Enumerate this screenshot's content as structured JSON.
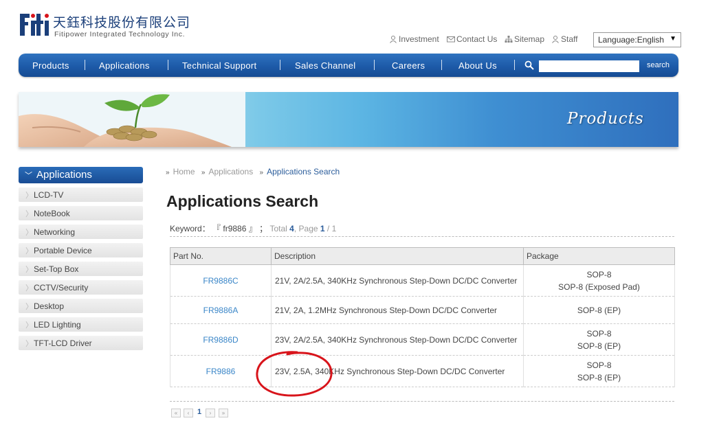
{
  "header": {
    "logo_mark": "fiti",
    "company_cn": "天鈺科技股份有限公司",
    "company_en": "Fitipower Integrated Technology Inc.",
    "top_links": [
      {
        "label": "Investment",
        "icon": "person-icon"
      },
      {
        "label": "Contact Us",
        "icon": "envelope-icon"
      },
      {
        "label": "Sitemap",
        "icon": "sitemap-icon"
      },
      {
        "label": "Staff",
        "icon": "person-icon"
      }
    ],
    "language": "Language:English"
  },
  "nav": {
    "items": [
      "Products",
      "Applications",
      "Technical Support",
      "Sales Channel",
      "Careers",
      "About Us"
    ],
    "search_button": "search",
    "search_value": ""
  },
  "banner": {
    "title": "Products"
  },
  "sidebar": {
    "header": "Applications",
    "items": [
      "LCD-TV",
      "NoteBook",
      "Networking",
      "Portable Device",
      "Set-Top Box",
      "CCTV/Security",
      "Desktop",
      "LED Lighting",
      "TFT-LCD Driver"
    ]
  },
  "breadcrumb": [
    "Home",
    "Applications",
    "Applications Search"
  ],
  "main": {
    "title": "Applications Search",
    "keyword_label": "Keyword：",
    "keyword_value": "『 fr9886 』",
    "keyword_sep": "；",
    "total_label": "Total",
    "total_value": "4",
    "page_label": ", Page",
    "page_value": "1",
    "page_total": "/ 1"
  },
  "table": {
    "headers": [
      "Part No.",
      "Description",
      "Package"
    ],
    "rows": [
      {
        "part": "FR9886C",
        "desc": "21V, 2A/2.5A, 340KHz Synchronous Step-Down DC/DC Converter",
        "pkg": [
          "SOP-8",
          "SOP-8 (Exposed Pad)"
        ]
      },
      {
        "part": "FR9886A",
        "desc": "21V, 2A, 1.2MHz Synchronous Step-Down DC/DC Converter",
        "pkg": [
          "SOP-8 (EP)"
        ]
      },
      {
        "part": "FR9886D",
        "desc": "23V, 2A/2.5A, 340KHz Synchronous Step-Down DC/DC Converter",
        "pkg": [
          "SOP-8",
          "SOP-8 (EP)"
        ]
      },
      {
        "part": "FR9886",
        "desc": "23V, 2.5A, 340KHz Synchronous Step-Down DC/DC Converter",
        "pkg": [
          "SOP-8",
          "SOP-8 (EP)"
        ]
      }
    ]
  },
  "pagination": {
    "first": "«",
    "prev": "‹",
    "current": "1",
    "next": "›",
    "last": "»"
  },
  "colors": {
    "nav_blue": "#1d5aa8",
    "link_blue": "#3a86c8",
    "annotation_red": "#d8141b"
  }
}
